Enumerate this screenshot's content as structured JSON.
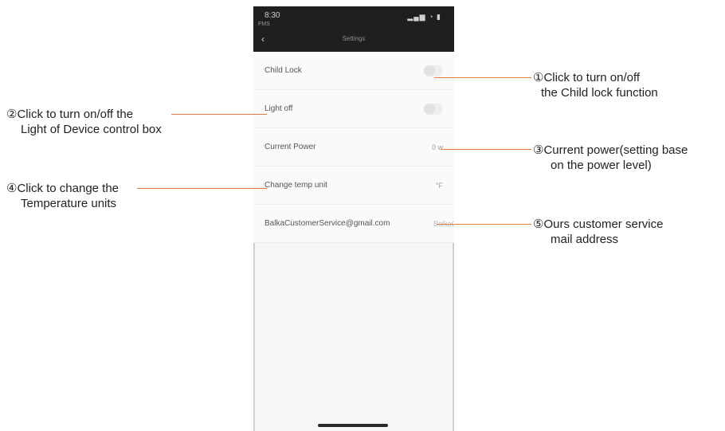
{
  "phone": {
    "status": {
      "time": "8:30",
      "carrier": "FMS"
    },
    "header": {
      "title": "Settings"
    },
    "rows": {
      "child_lock": {
        "label": "Child Lock"
      },
      "light_off": {
        "label": "Light off"
      },
      "current_power": {
        "label": "Current Power",
        "value": "0 w"
      },
      "temp_unit": {
        "label": "Change temp unit",
        "value": "°F"
      },
      "email": {
        "label": "BalkaCustomerService@gmail.com",
        "value": "BalkaCu"
      }
    }
  },
  "annotations": {
    "a1": {
      "line1": "①Click to turn on/off",
      "line2": "the Child lock function"
    },
    "a2": {
      "line1": "②Click to turn on/off the",
      "line2": "Light of Device control box"
    },
    "a3": {
      "line1": "③Current power(setting base",
      "line2": "on the power level)"
    },
    "a4": {
      "line1": "④Click to change the",
      "line2": "Temperature units"
    },
    "a5": {
      "line1": "⑤Ours customer service",
      "line2": "mail address"
    }
  },
  "colors": {
    "accent_line": "#e57a3f",
    "topbar": "#1f1f1f"
  },
  "icons": [
    "back-icon",
    "signal-icon",
    "wifi-icon",
    "battery-icon"
  ]
}
